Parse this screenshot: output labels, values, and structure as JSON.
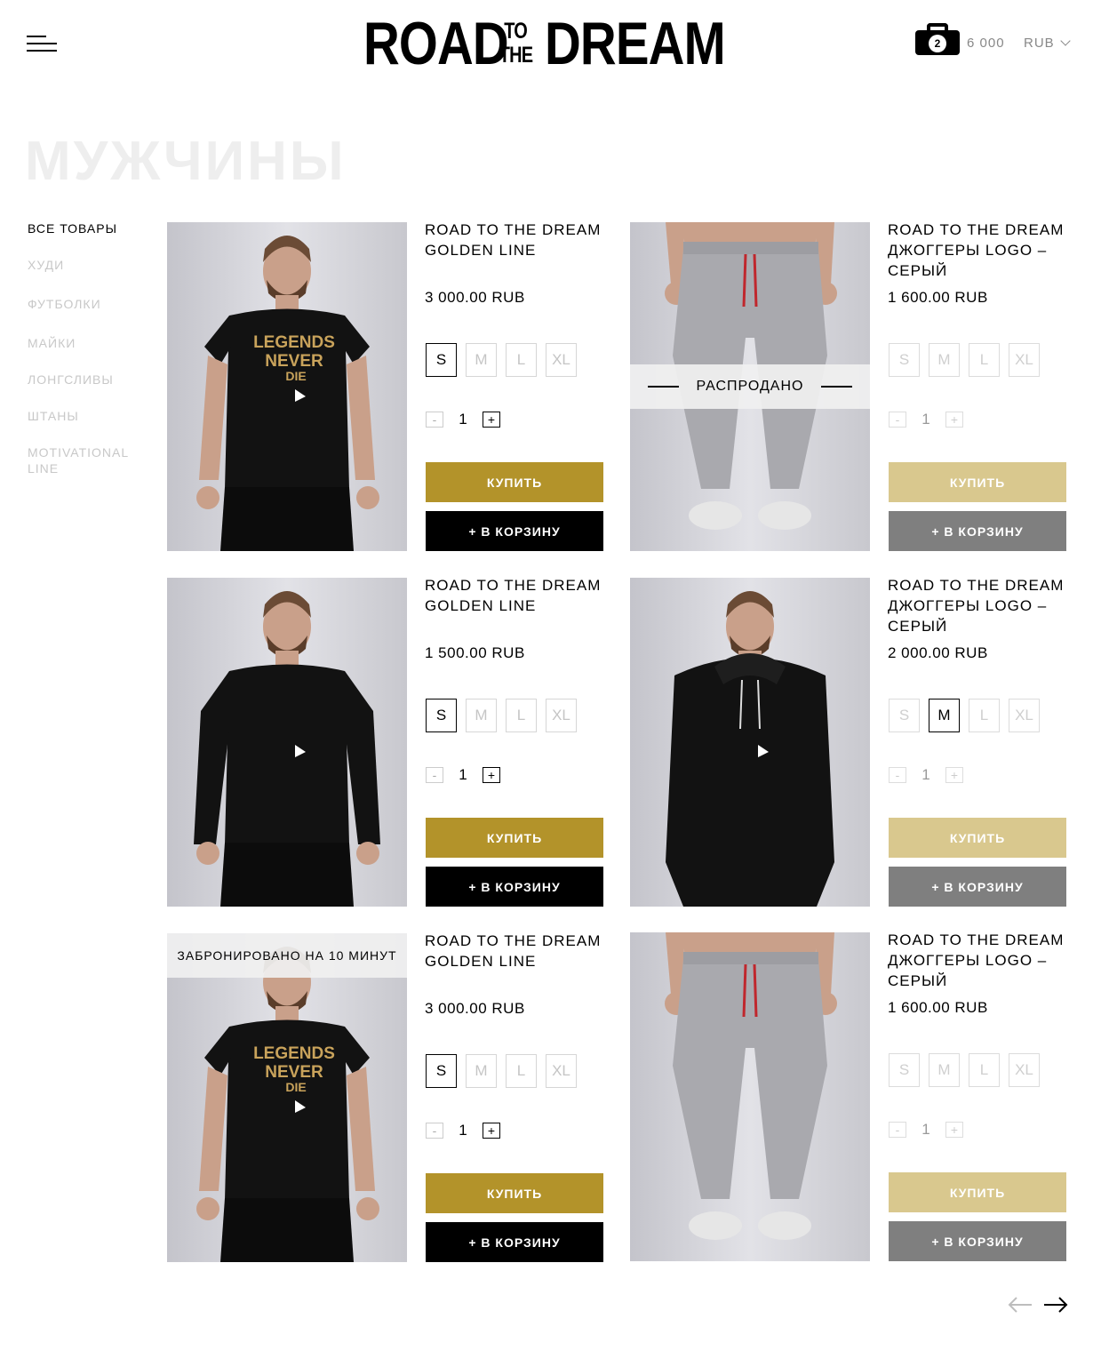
{
  "header": {
    "logo_road": "ROAD",
    "logo_to": "TO",
    "logo_the": "THE",
    "logo_dream": "DREAM",
    "cart_count": "2",
    "cart_total": "6 000",
    "currency": "RUB"
  },
  "page_title": "МУЖЧИНЫ",
  "sidebar": {
    "items": [
      {
        "label": "ВСЕ ТОВАРЫ",
        "active": true
      },
      {
        "label": "ХУДИ"
      },
      {
        "label": "ФУТБОЛКИ"
      },
      {
        "label": "МАЙКИ"
      },
      {
        "label": "ЛОНГСЛИВЫ"
      },
      {
        "label": "ШТАНЫ"
      },
      {
        "label": "MOTIVATIONAL LINE"
      }
    ]
  },
  "products": [
    {
      "title": "ROAD TO THE DREAM GOLDEN LINE",
      "price": "3 000.00 RUB",
      "sizes": [
        "S",
        "M",
        "L",
        "XL"
      ],
      "selected": "S",
      "qty": "1",
      "buy": "КУПИТЬ",
      "add": "+ В КОРЗИНУ",
      "image": "tshirt-photo"
    },
    {
      "title": "ROAD TO THE DREAM ДЖОГГЕРЫ LOGO – СЕРЫЙ",
      "price": "1 600.00 RUB",
      "sizes": [
        "S",
        "M",
        "L",
        "XL"
      ],
      "selected": "",
      "qty": "1",
      "buy": "КУПИТЬ",
      "add": "+ В КОРЗИНУ",
      "image": "joggers-photo",
      "banner": "РАСПРОДАНО"
    },
    {
      "title": "ROAD TO THE DREAM GOLDEN LINE",
      "price": "1 500.00 RUB",
      "sizes": [
        "S",
        "M",
        "L",
        "XL"
      ],
      "selected": "S",
      "qty": "1",
      "buy": "КУПИТЬ",
      "add": "+ В КОРЗИНУ",
      "image": "longsleeve-photo"
    },
    {
      "title": "ROAD TO THE DREAM ДЖОГГЕРЫ LOGO – СЕРЫЙ",
      "price": "2 000.00 RUB",
      "sizes": [
        "S",
        "M",
        "L",
        "XL"
      ],
      "selected": "M",
      "qty": "1",
      "buy": "КУПИТЬ",
      "add": "+ В КОРЗИНУ",
      "image": "hoodie-photo"
    },
    {
      "title": "ROAD TO THE DREAM GOLDEN LINE",
      "price": "3 000.00 RUB",
      "sizes": [
        "S",
        "M",
        "L",
        "XL"
      ],
      "selected": "S",
      "qty": "1",
      "buy": "КУПИТЬ",
      "add": "+ В КОРЗИНУ",
      "image": "tshirt-photo",
      "banner": "ЗАБРОНИРОВАНО НА 10 МИНУТ"
    },
    {
      "title": "ROAD TO THE DREAM ДЖОГГЕРЫ LOGO – СЕРЫЙ",
      "price": "1 600.00 RUB",
      "sizes": [
        "S",
        "M",
        "L",
        "XL"
      ],
      "selected": "",
      "qty": "1",
      "buy": "КУПИТЬ",
      "add": "+ В КОРЗИНУ",
      "image": "joggers-photo"
    }
  ],
  "shirt_print": [
    "LEGENDS",
    "NEVER",
    "DIE"
  ],
  "colors": {
    "gold": "#b3932a",
    "gold_disabled": "#d9c88e",
    "grey_button": "#7f7f7f",
    "title_grey": "#eeeeee"
  }
}
